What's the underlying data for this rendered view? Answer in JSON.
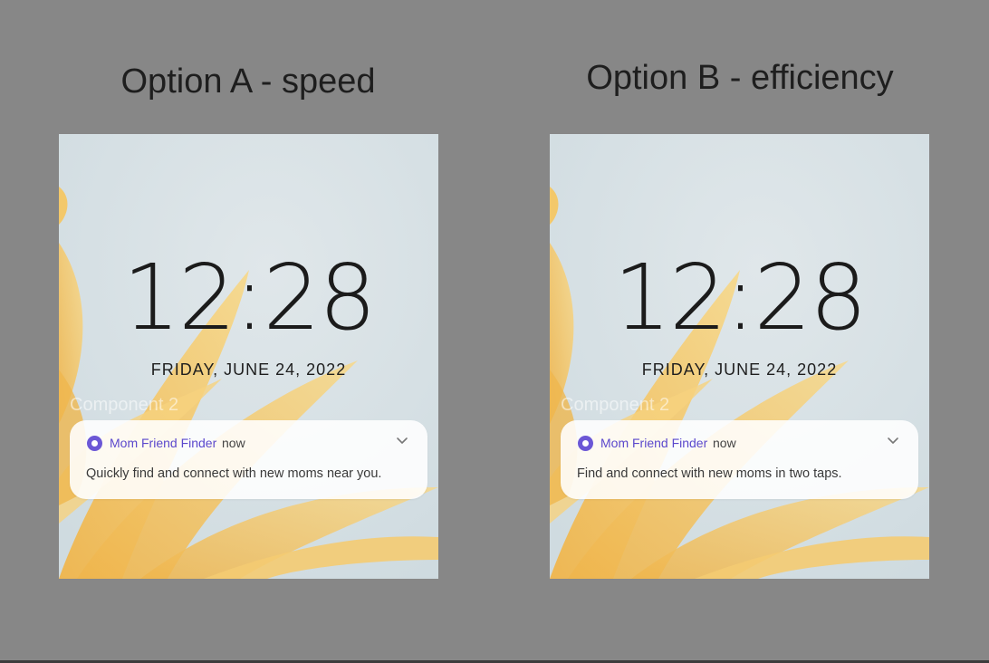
{
  "options": [
    {
      "title": "Option A - speed",
      "clock": "12:28",
      "date": "FRIDAY, JUNE 24, 2022",
      "component_label": "Component 2",
      "notification": {
        "app_name": "Mom Friend Finder",
        "time": "now",
        "body": "Quickly find and connect with new moms near you.",
        "app_icon": "radio-dot-icon",
        "expand_icon": "chevron-down-icon"
      }
    },
    {
      "title": "Option B - efficiency",
      "clock": "12:28",
      "date": "FRIDAY, JUNE 24, 2022",
      "component_label": "Component 2",
      "notification": {
        "app_name": "Mom Friend Finder",
        "time": "now",
        "body": "Find and connect with new moms in two taps.",
        "app_icon": "radio-dot-icon",
        "expand_icon": "chevron-down-icon"
      }
    }
  ],
  "colors": {
    "background": "#878787",
    "wallpaper_sky": "#d6e1e4",
    "petal": "#f2c463",
    "accent": "#6b57d6"
  }
}
